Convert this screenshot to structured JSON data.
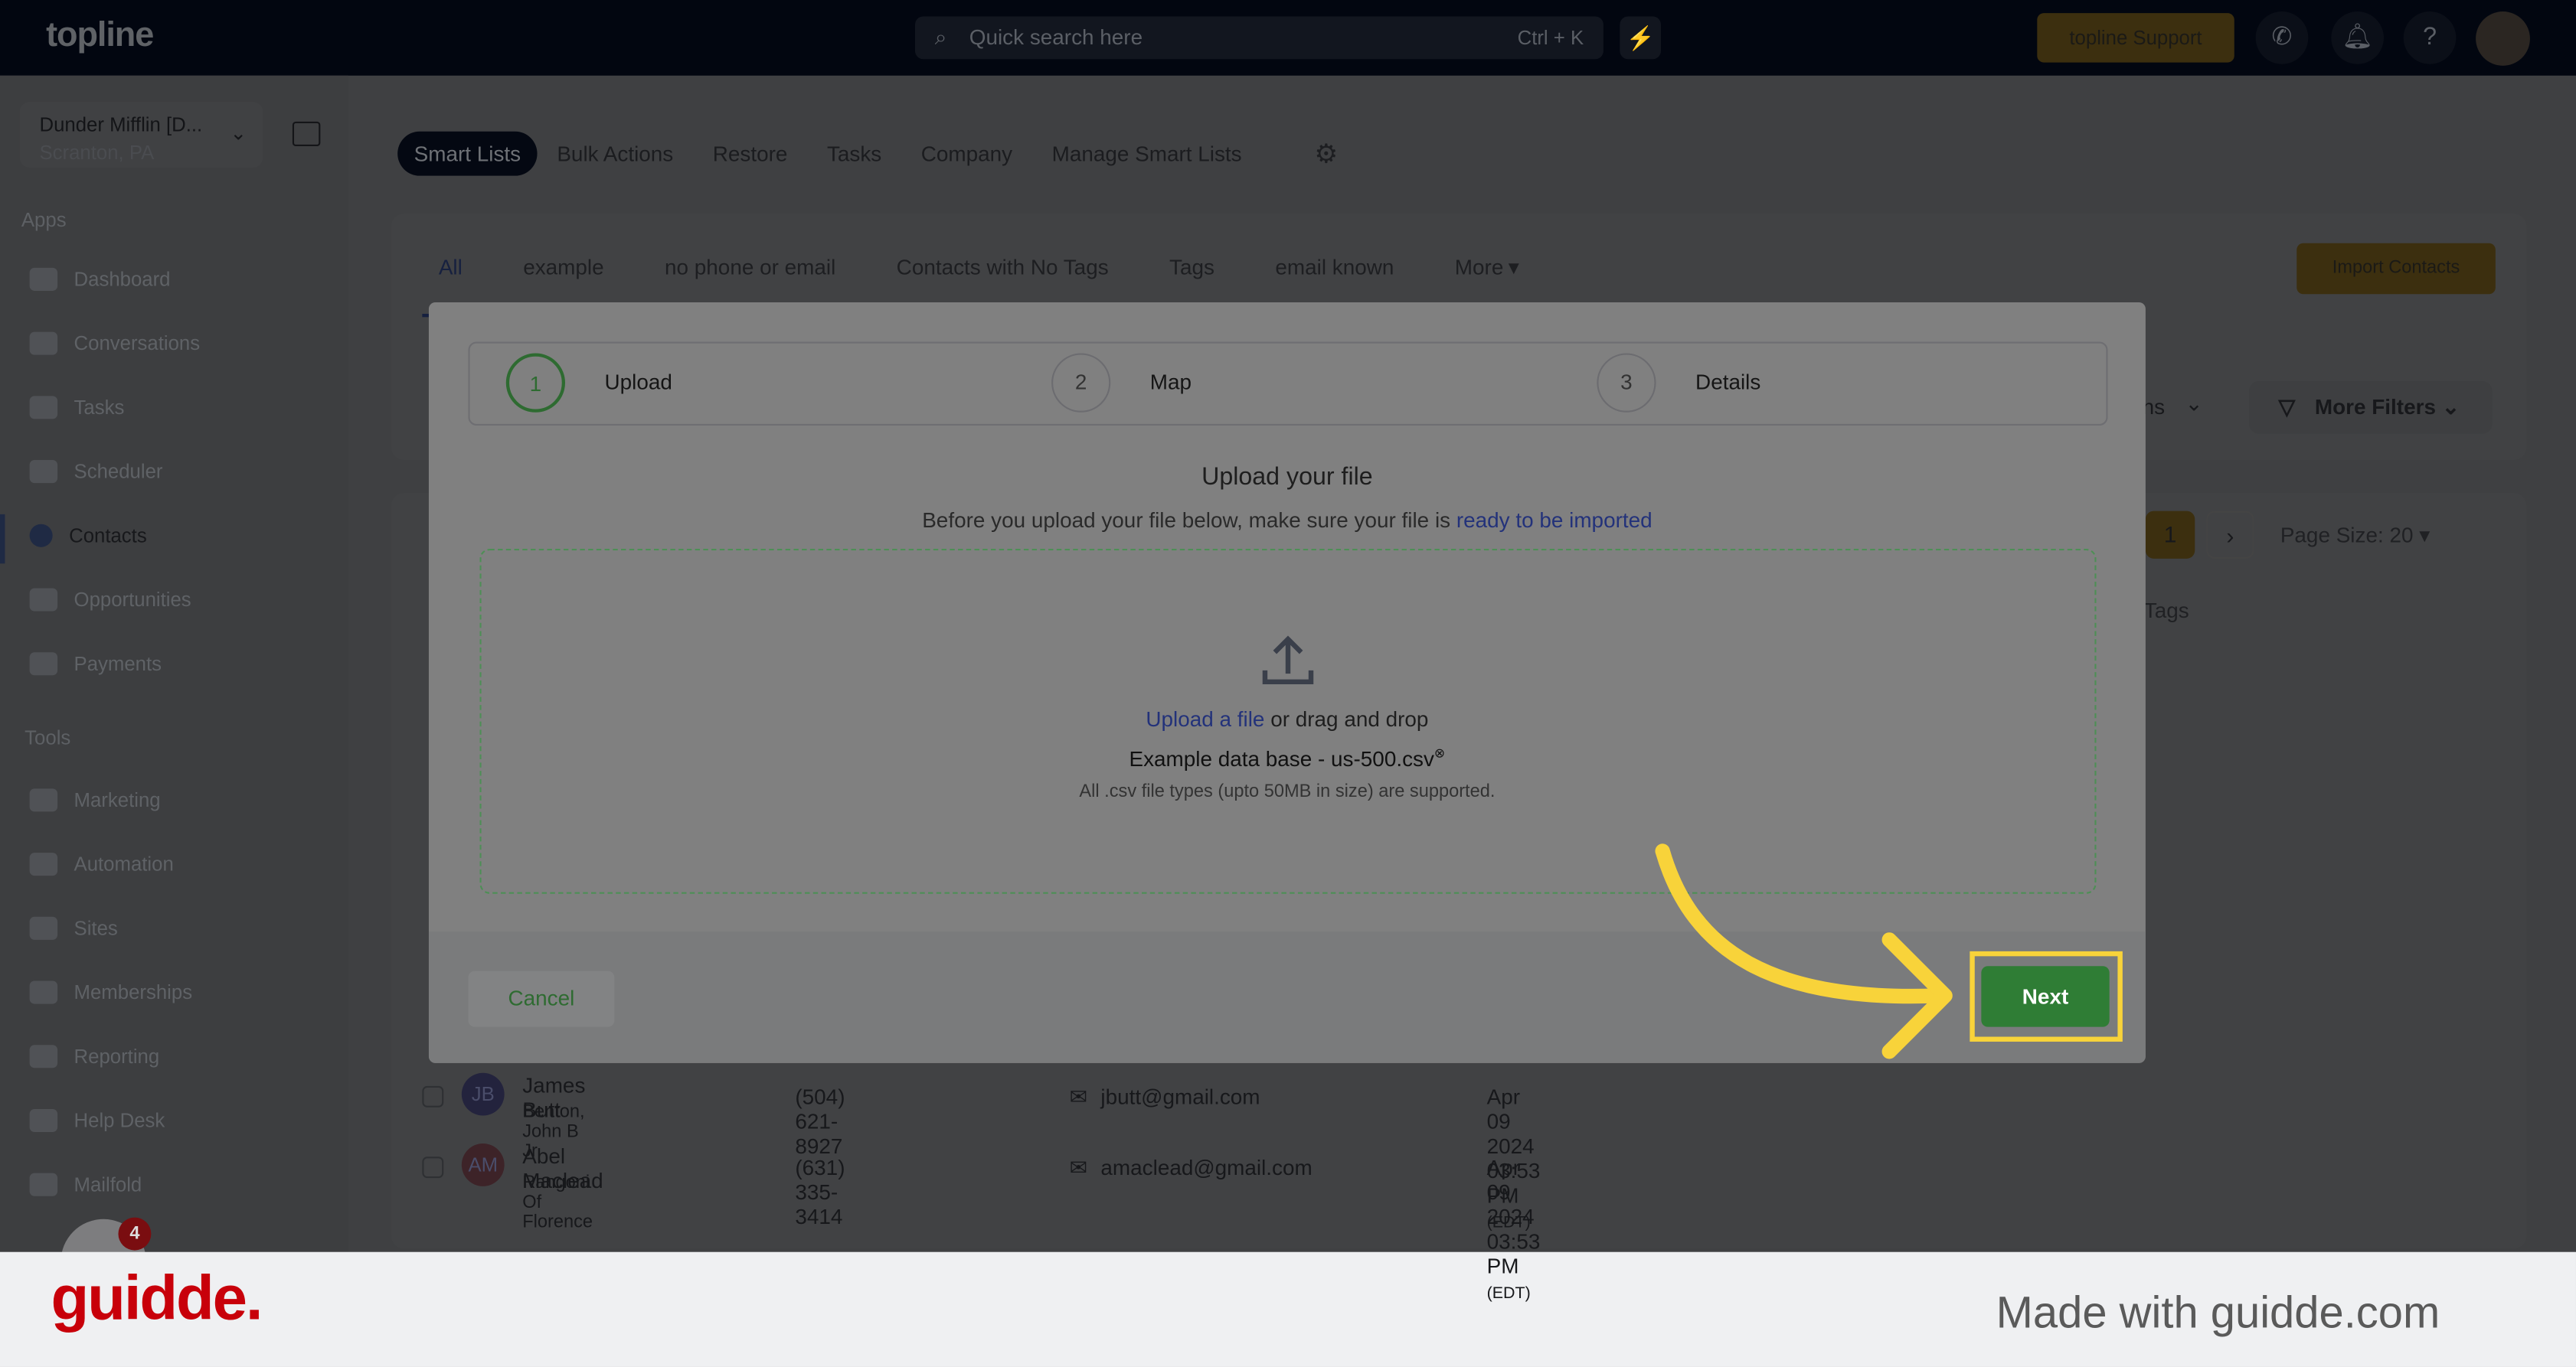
{
  "app": {
    "logo": "topline",
    "search_placeholder": "Quick search here",
    "search_shortcut": "Ctrl + K",
    "support_label": "topline Support"
  },
  "account": {
    "name": "Dunder Mifflin [D...",
    "location": "Scranton, PA"
  },
  "sidebar": {
    "apps_heading": "Apps",
    "apps": [
      {
        "label": "Dashboard"
      },
      {
        "label": "Conversations"
      },
      {
        "label": "Tasks"
      },
      {
        "label": "Scheduler"
      },
      {
        "label": "Contacts",
        "active": true
      },
      {
        "label": "Opportunities"
      },
      {
        "label": "Payments"
      }
    ],
    "tools_heading": "Tools",
    "tools": [
      {
        "label": "Marketing"
      },
      {
        "label": "Automation"
      },
      {
        "label": "Sites"
      },
      {
        "label": "Memberships"
      },
      {
        "label": "Reporting"
      },
      {
        "label": "Help Desk"
      },
      {
        "label": "Mailfold"
      }
    ],
    "badge": "4"
  },
  "top_tabs": [
    {
      "label": "Smart Lists",
      "active": true
    },
    {
      "label": "Bulk Actions"
    },
    {
      "label": "Restore"
    },
    {
      "label": "Tasks"
    },
    {
      "label": "Company"
    },
    {
      "label": "Manage Smart Lists"
    }
  ],
  "list_tabs": [
    {
      "label": "All",
      "active": true
    },
    {
      "label": "example"
    },
    {
      "label": "no phone or email"
    },
    {
      "label": "Contacts with No Tags"
    },
    {
      "label": "Tags"
    },
    {
      "label": "email known"
    },
    {
      "label": "More"
    }
  ],
  "import_contacts": "Import Contacts",
  "filters": {
    "columns_partial": "ns",
    "more_filters": "More Filters"
  },
  "pagination": {
    "current": "1",
    "page_size": "Page Size: 20"
  },
  "table": {
    "tags_header": "Tags",
    "rows": [
      {
        "initials": "JB",
        "name": "James Butt",
        "company": "Benton, John B Jr",
        "phone": "(504) 621-8927",
        "email": "jbutt@gmail.com",
        "date": "Apr 09 2024 03:53 PM",
        "tz": "(EDT)",
        "color": "#23233d"
      },
      {
        "initials": "AM",
        "name": "Abel Maclead",
        "company": "Rangoni Of Florence",
        "phone": "(631) 335-3414",
        "email": "amaclead@gmail.com",
        "date": "Apr 09 2024 03:53 PM",
        "tz": "(EDT)",
        "color": "#3d2328"
      }
    ]
  },
  "modal": {
    "steps": [
      {
        "num": "1",
        "label": "Upload",
        "active": true
      },
      {
        "num": "2",
        "label": "Map"
      },
      {
        "num": "3",
        "label": "Details"
      }
    ],
    "title": "Upload your file",
    "subtitle": "Before you upload your file below, make sure your file is ",
    "subtitle_link": "ready to be imported",
    "upload_link": "Upload a file",
    "upload_rest": " or drag and drop",
    "file_name": "Example data base - us-500.csv",
    "hint": "All .csv file types (upto 50MB in size) are supported.",
    "cancel": "Cancel",
    "next": "Next"
  },
  "colors": {
    "accent_green": "#2f7d35",
    "highlight": "#f8d33a",
    "brand_red": "#c8000a"
  },
  "footer": {
    "brand": "guidde.",
    "made_with": "Made with guidde.com"
  }
}
